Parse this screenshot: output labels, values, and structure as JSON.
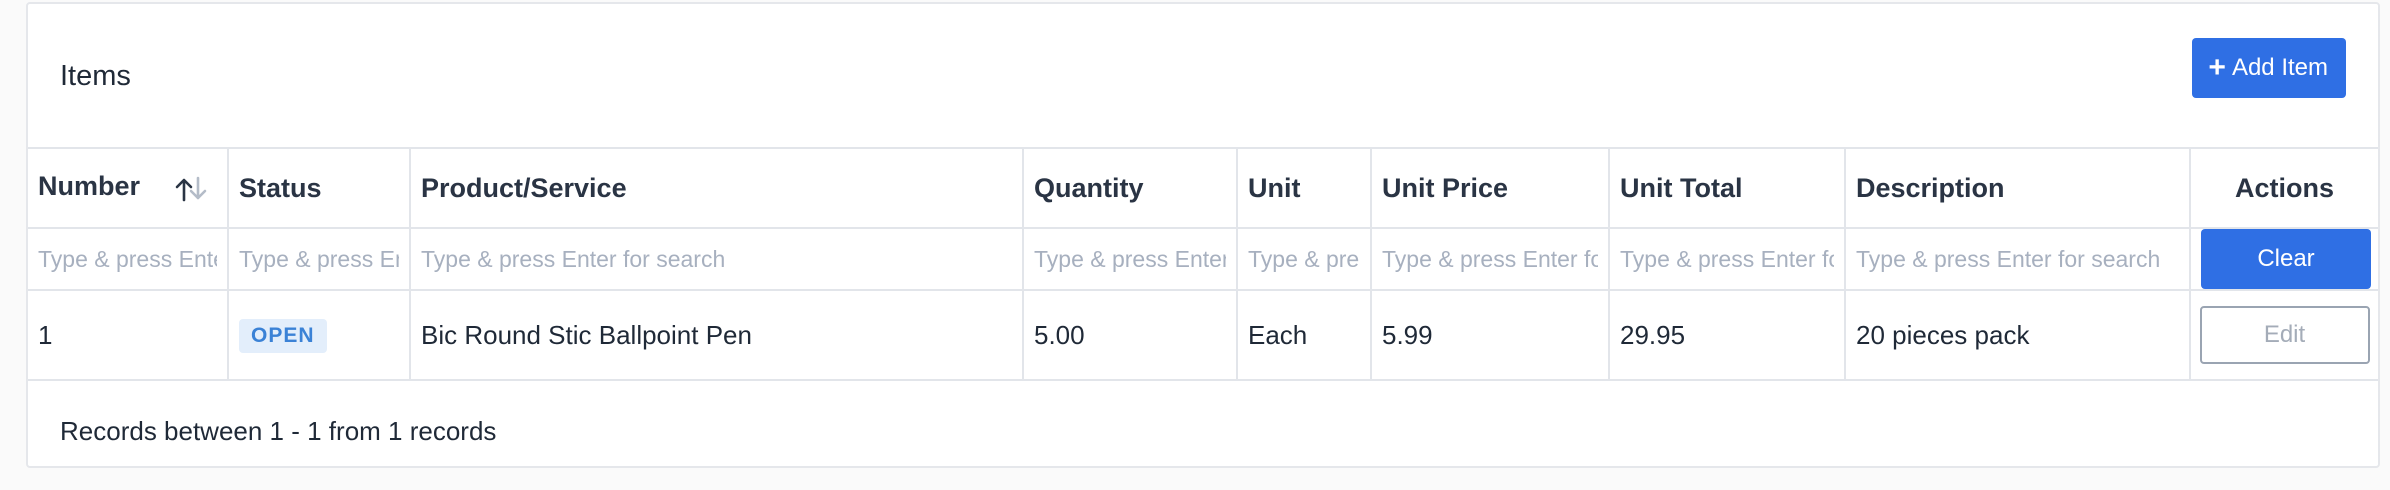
{
  "card": {
    "title": "Items",
    "add_button_label": "Add Item",
    "add_button_icon": "plus-icon"
  },
  "table": {
    "columns": [
      {
        "key": "number",
        "label": "Number",
        "sortable": true,
        "sort_icon": "sort-ascending-icon"
      },
      {
        "key": "status",
        "label": "Status"
      },
      {
        "key": "product",
        "label": "Product/Service"
      },
      {
        "key": "quantity",
        "label": "Quantity"
      },
      {
        "key": "unit",
        "label": "Unit"
      },
      {
        "key": "unit_price",
        "label": "Unit Price"
      },
      {
        "key": "unit_total",
        "label": "Unit Total"
      },
      {
        "key": "description",
        "label": "Description"
      },
      {
        "key": "actions",
        "label": "Actions"
      }
    ],
    "filter_placeholder": "Type & press Enter for search",
    "filter_values": [
      "",
      "",
      "",
      "",
      "",
      "",
      "",
      ""
    ],
    "clear_label": "Clear",
    "rows": [
      {
        "number": "1",
        "status": "OPEN",
        "product": "Bic Round Stic Ballpoint Pen",
        "quantity": "5.00",
        "unit": "Each",
        "unit_price": "5.99",
        "unit_total": "29.95",
        "description": "20 pieces pack",
        "action_label": "Edit"
      }
    ]
  },
  "footer": {
    "records_text": "Records between 1 - 1 from 1 records"
  },
  "colors": {
    "primary": "#2f6fe4",
    "badge_bg": "#e3eefb",
    "badge_text": "#3b82d6",
    "border": "#e2e5ea"
  }
}
